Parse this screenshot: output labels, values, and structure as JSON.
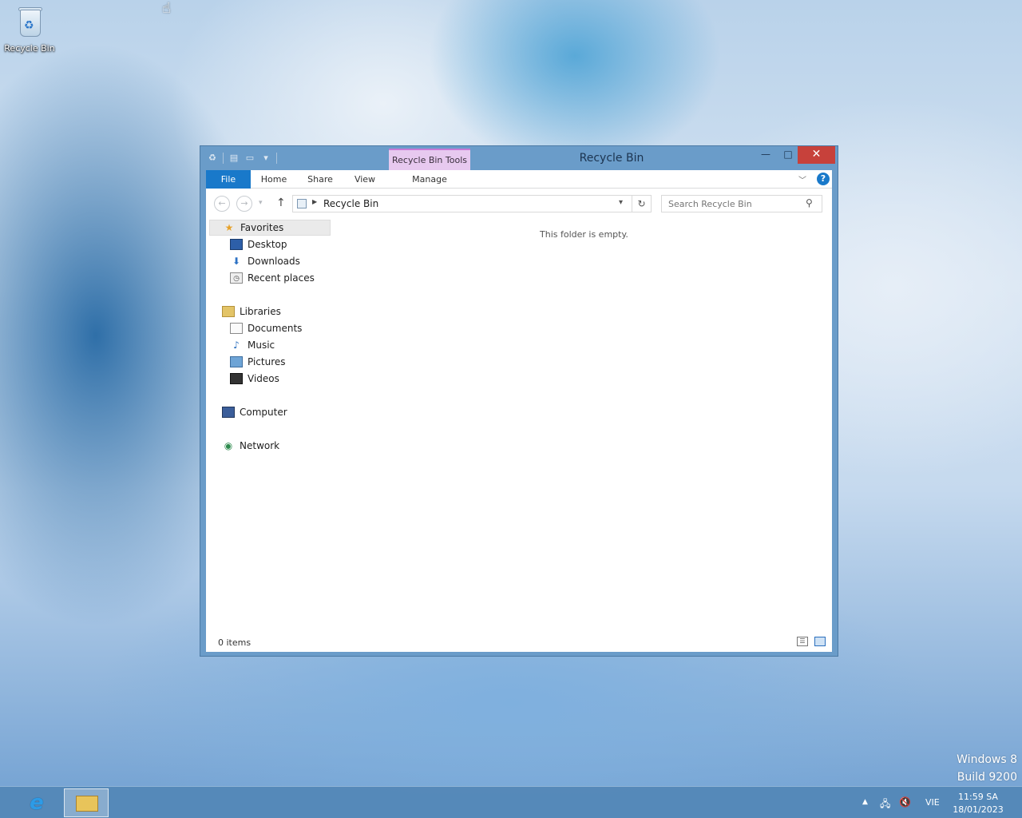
{
  "desktop": {
    "recycle_bin_label": "Recycle Bin",
    "watermark_line1": "Windows 8",
    "watermark_line2": "Build 9200"
  },
  "window": {
    "title": "Recycle Bin",
    "contextual_tab": "Recycle Bin Tools",
    "buttons": {
      "minimize": "—",
      "maximize": "□",
      "close": "✕"
    }
  },
  "ribbon": {
    "tabs": [
      "File",
      "Home",
      "Share",
      "View",
      "Manage"
    ],
    "help": "?"
  },
  "navigation": {
    "address_crumb": "Recycle Bin",
    "search_placeholder": "Search Recycle Bin"
  },
  "nav_pane": {
    "favorites": "Favorites",
    "desktop": "Desktop",
    "downloads": "Downloads",
    "recent_places": "Recent places",
    "libraries": "Libraries",
    "documents": "Documents",
    "music": "Music",
    "pictures": "Pictures",
    "videos": "Videos",
    "computer": "Computer",
    "network": "Network"
  },
  "content": {
    "empty_message": "This folder is empty."
  },
  "status": {
    "item_count": "0 items"
  },
  "taskbar": {
    "language": "VIE",
    "time": "11:59 SA",
    "date": "18/01/2023"
  },
  "colors": {
    "accent_file_tab": "#1979ca",
    "contextual_tab": "#e7c9ef",
    "close_button": "#c7413b",
    "window_frame": "#6a9cc9"
  }
}
